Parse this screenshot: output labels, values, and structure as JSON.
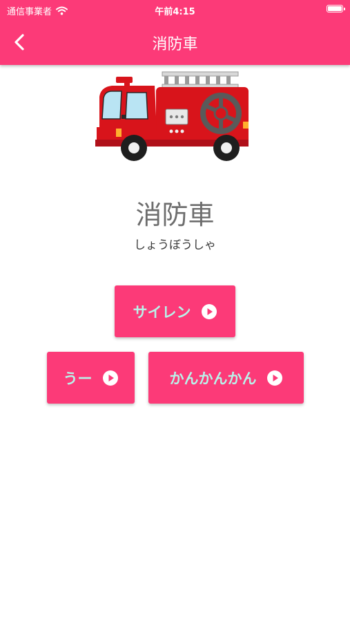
{
  "status_bar": {
    "carrier": "通信事業者",
    "time": "午前4:15"
  },
  "nav": {
    "title": "消防車"
  },
  "card": {
    "word": "消防車",
    "reading": "しょうぼうしゃ"
  },
  "sounds": [
    {
      "label": "サイレン"
    },
    {
      "label": "うー"
    },
    {
      "label": "かんかんかん"
    }
  ],
  "colors": {
    "accent": "#fc3a78",
    "button_text": "#b9f3ea"
  }
}
